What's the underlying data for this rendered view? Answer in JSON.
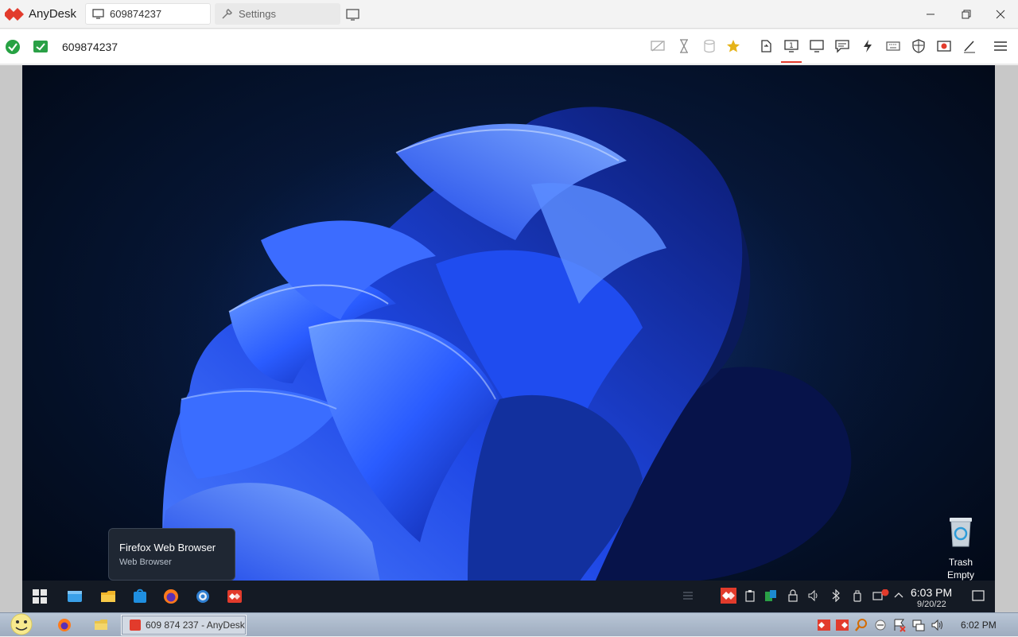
{
  "titlebar": {
    "app_name": "AnyDesk",
    "tabs": [
      {
        "label": "609874237",
        "icon": "monitor-icon"
      },
      {
        "label": "Settings",
        "icon": "wrench-icon"
      }
    ]
  },
  "toolbar": {
    "session_id": "609874237",
    "icons": [
      "disable-input-icon",
      "hourglass-icon",
      "database-icon",
      "favorite-star-icon",
      "transfer-icon",
      "display-icon",
      "screen-mode-icon",
      "chat-icon",
      "actions-icon",
      "keyboard-icon",
      "privacy-icon",
      "record-icon",
      "whiteboard-icon",
      "menu-icon"
    ]
  },
  "remote": {
    "trash": {
      "label": "Trash",
      "status": "Empty"
    },
    "tooltip": {
      "title": "Firefox Web Browser",
      "subtitle": "Web Browser"
    },
    "clock_time": "6:03 PM",
    "clock_date": "9/20/22"
  },
  "local_taskbar": {
    "task_label": "609 874 237 - AnyDesk",
    "clock": "6:02 PM"
  },
  "colors": {
    "accent": "#e23b2c",
    "ok_green": "#27a243",
    "remote_taskbar": "#141a24"
  }
}
